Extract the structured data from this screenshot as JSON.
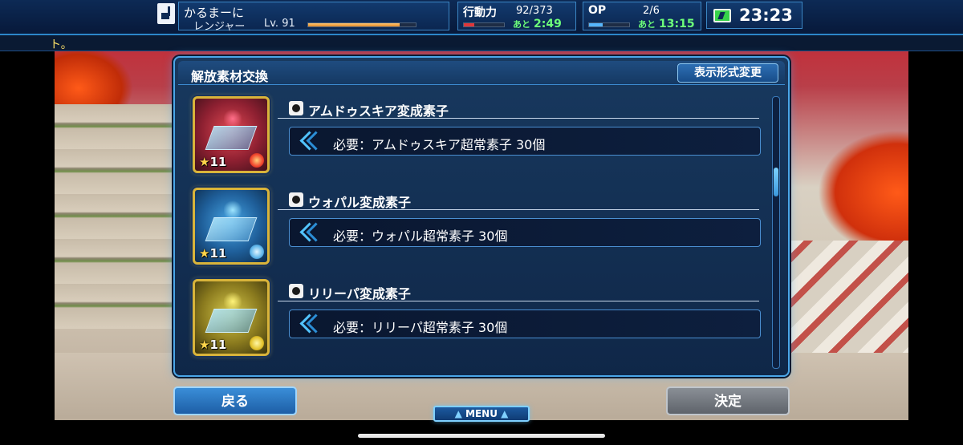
{
  "status": {
    "player_name": "かるまーに",
    "player_class": "レンジャー",
    "player_level": "Lv. 91",
    "exp_progress": 0.85,
    "action_label": "行動力",
    "action_value": "92/373",
    "action_timer_prefix": "あと",
    "action_timer": "2:49",
    "action_progress": 0.25,
    "op_label": "OP",
    "op_value": "2/6",
    "op_timer_prefix": "あと",
    "op_timer": "13:15",
    "op_progress": 0.33,
    "clock": "23:23"
  },
  "ticker": {
    "text": "ト。"
  },
  "dialog": {
    "title": "解放素材交換",
    "format_button": "表示形式変更",
    "items": [
      {
        "name": "アムドゥスキア変成素子",
        "requirement": "必要：アムドゥスキア超常素子 30個",
        "rarity": "11",
        "element": "fire"
      },
      {
        "name": "ウォパル変成素子",
        "requirement": "必要：ウォパル超常素子 30個",
        "rarity": "11",
        "element": "ice"
      },
      {
        "name": "リリーパ変成素子",
        "requirement": "必要：リリーパ超常素子 30個",
        "rarity": "11",
        "element": "lightning"
      }
    ]
  },
  "buttons": {
    "back": "戻る",
    "confirm": "決定",
    "menu": "MENU"
  },
  "colors": {
    "accent": "#4aa6e8",
    "timer_green": "#6dff7a",
    "rarity_gold": "#ffd54a"
  }
}
